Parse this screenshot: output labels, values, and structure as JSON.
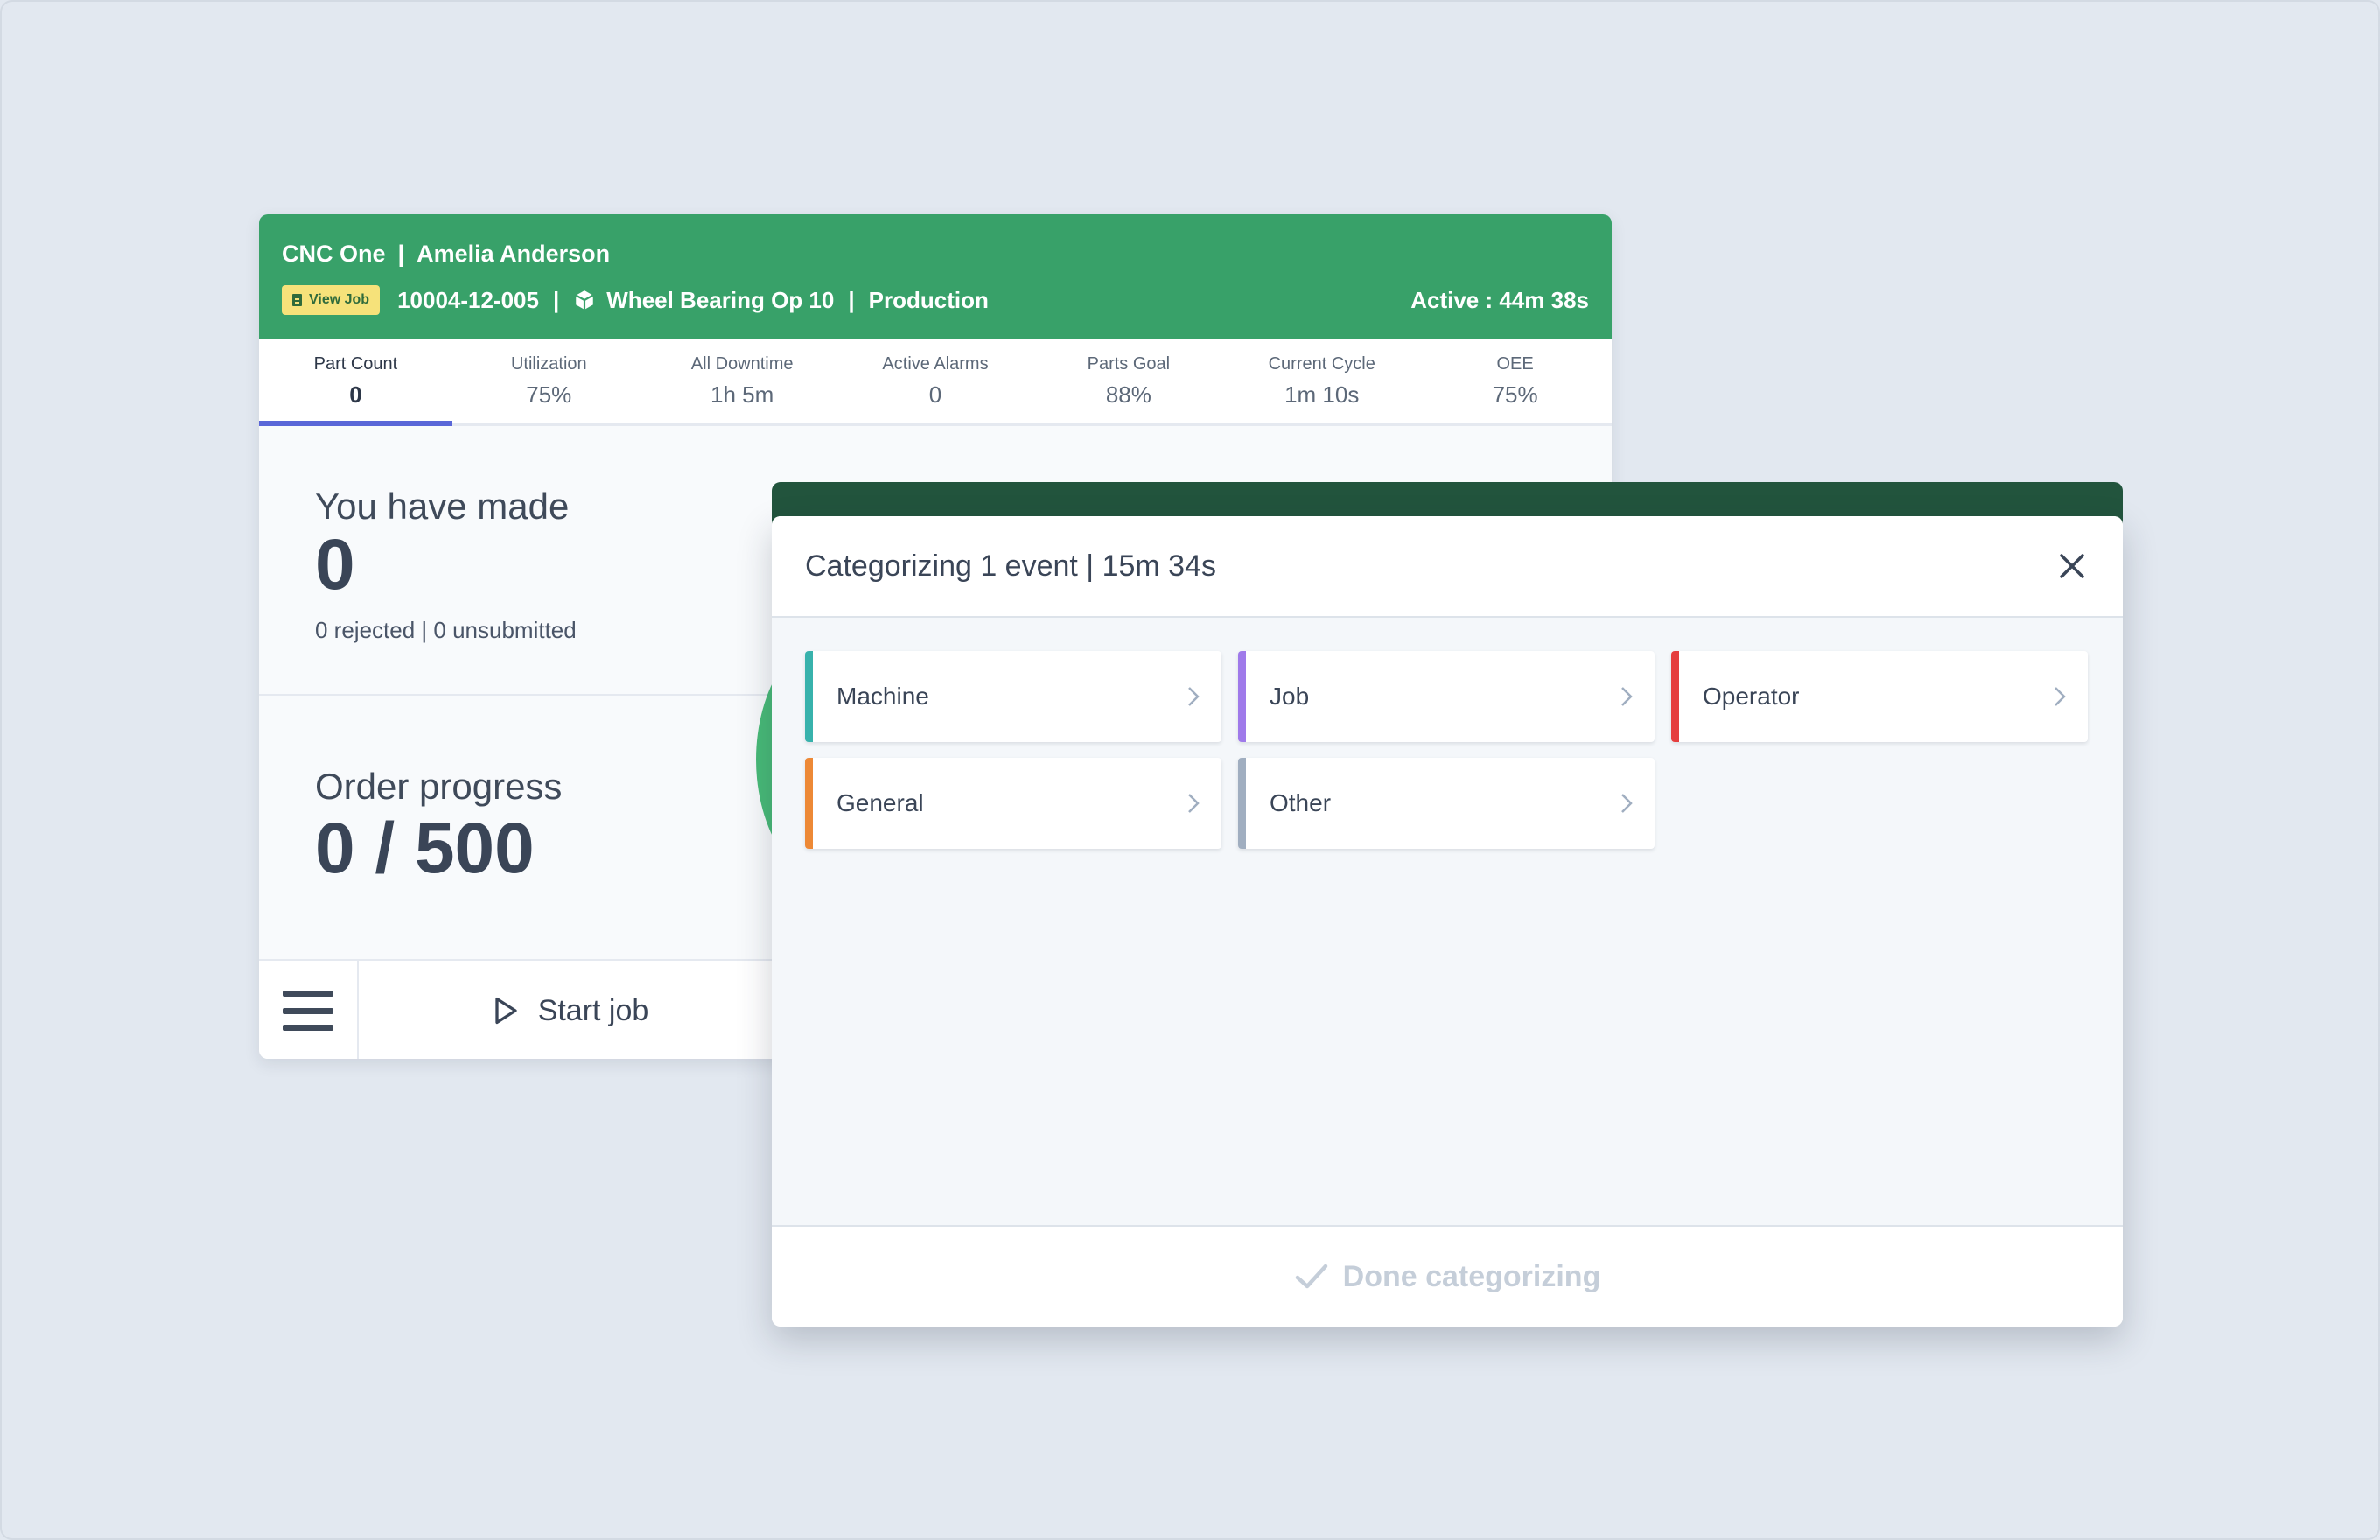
{
  "machine": {
    "name": "CNC One",
    "operator": "Amelia Anderson",
    "view_job_label": "View Job",
    "job_number": "10004-12-005",
    "part_name": "Wheel Bearing Op 10",
    "mode": "Production",
    "active_time": "Active : 44m 38s",
    "accent_color": "#38a169"
  },
  "stats": [
    {
      "label": "Part Count",
      "value": "0"
    },
    {
      "label": "Utilization",
      "value": "75%"
    },
    {
      "label": "All Downtime",
      "value": "1h 5m"
    },
    {
      "label": "Active Alarms",
      "value": "0"
    },
    {
      "label": "Parts Goal",
      "value": "88%"
    },
    {
      "label": "Current Cycle",
      "value": "1m 10s"
    },
    {
      "label": "OEE",
      "value": "75%"
    }
  ],
  "made": {
    "title": "You have made",
    "count": "0",
    "summary": "0 rejected | 0 unsubmitted"
  },
  "order": {
    "title": "Order progress",
    "value": "0 / 500"
  },
  "footer": {
    "start_label": "Start job"
  },
  "modal": {
    "title": "Categorizing 1 event | 15m 34s",
    "categories": [
      {
        "label": "Machine",
        "color": "#38b2ac"
      },
      {
        "label": "Job",
        "color": "#9f7aea"
      },
      {
        "label": "Operator",
        "color": "#e53e3e"
      },
      {
        "label": "General",
        "color": "#ed8936"
      },
      {
        "label": "Other",
        "color": "#a0aec0"
      }
    ],
    "done_label": "Done categorizing"
  }
}
